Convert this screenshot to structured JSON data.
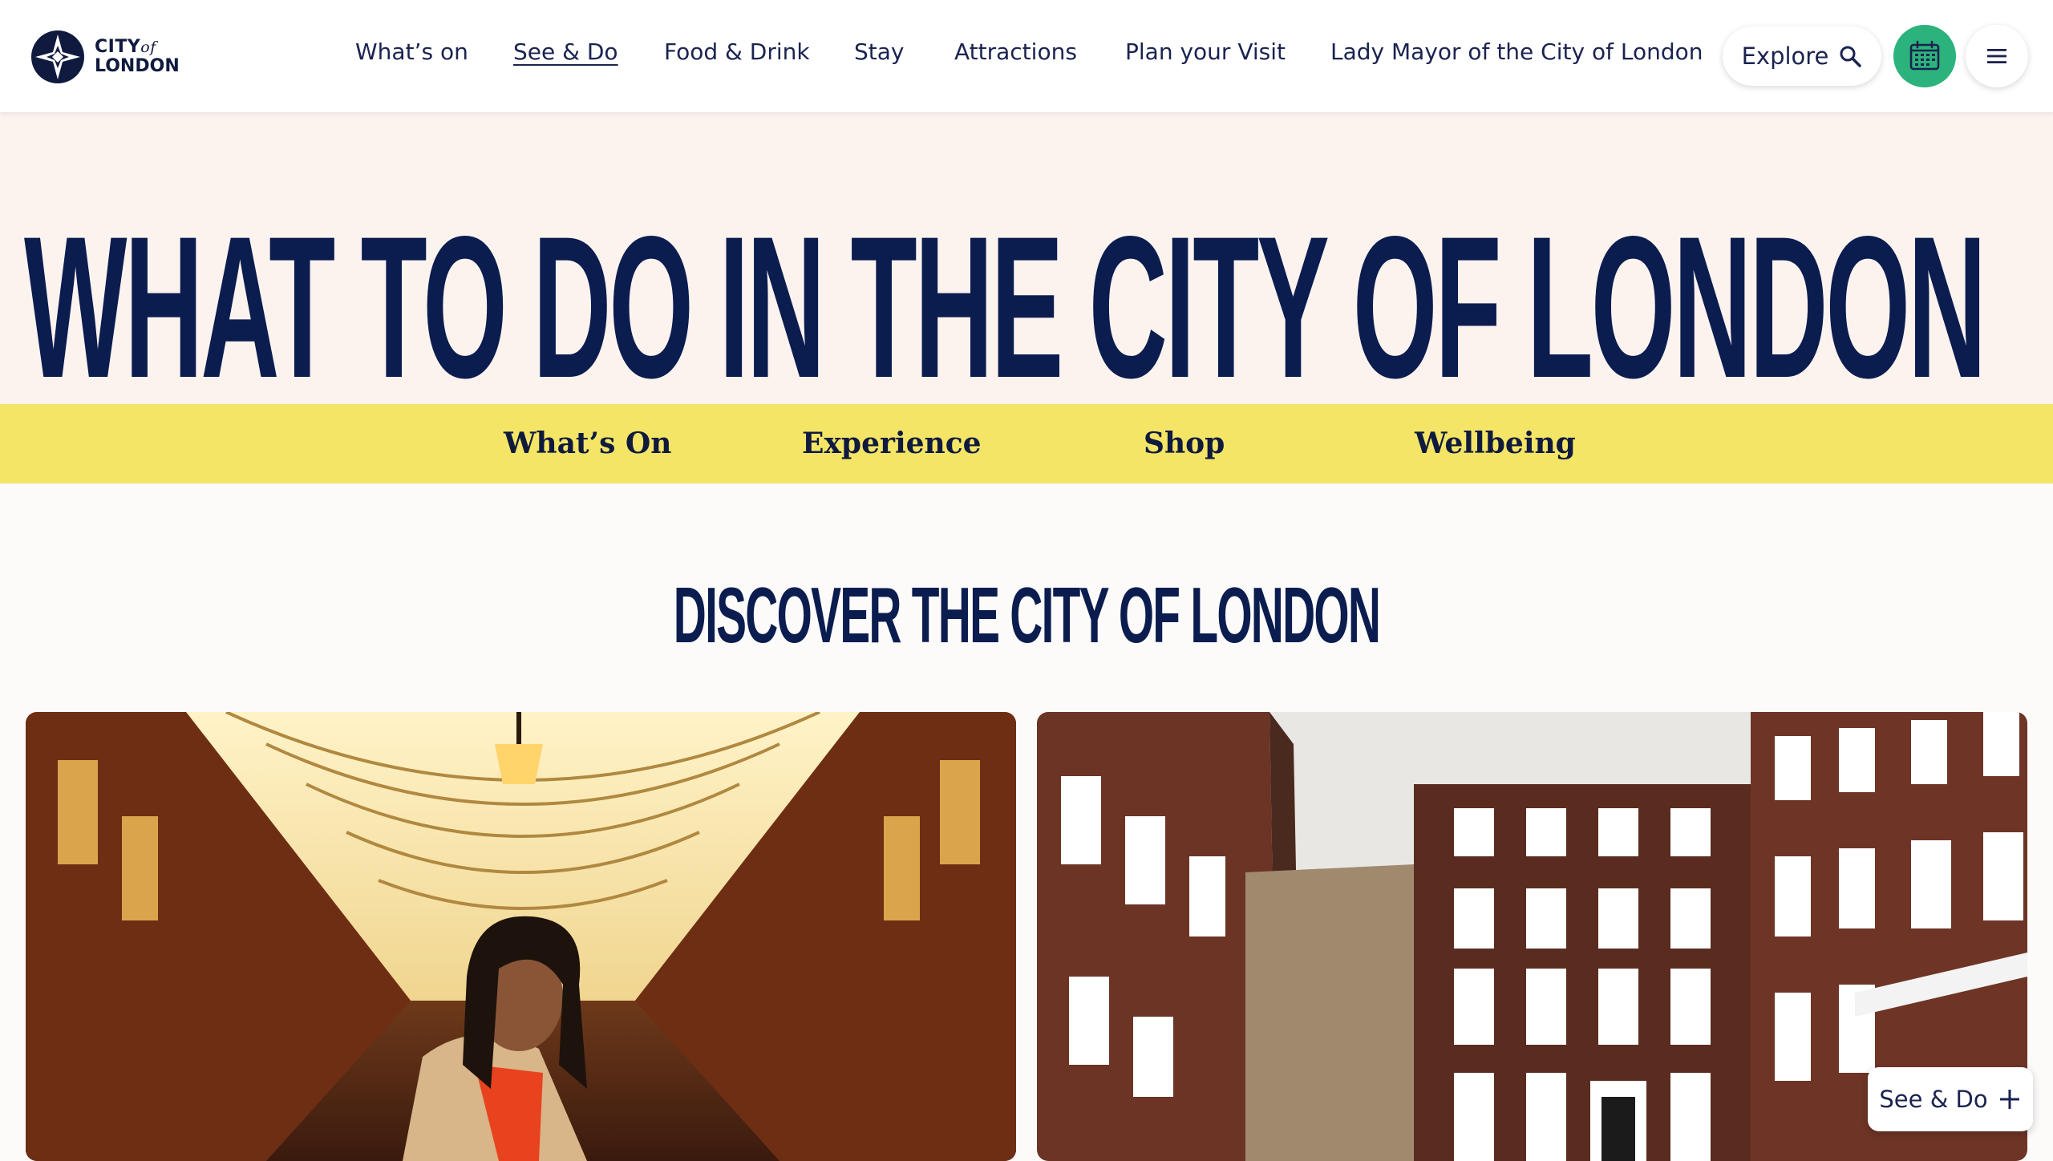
{
  "brand": {
    "logo_line1": "CITY",
    "logo_line1_suffix": "of",
    "logo_line2": "LONDON"
  },
  "header": {
    "nav": [
      {
        "label": "What’s on",
        "current": false
      },
      {
        "label": "See & Do",
        "current": true
      },
      {
        "label": "Food & Drink",
        "current": false
      },
      {
        "label": "Stay",
        "current": false
      },
      {
        "label": "Attractions",
        "current": false
      },
      {
        "label": "Plan your Visit",
        "current": false
      },
      {
        "label": "Lady Mayor of the City of London",
        "current": false
      }
    ],
    "explore_label": "Explore",
    "explore_icon": "search-icon",
    "calendar_icon": "calendar-icon",
    "menu_icon": "hamburger-menu-icon"
  },
  "hero": {
    "title": "WHAT TO DO IN THE CITY OF LONDON"
  },
  "subnav": {
    "items": [
      "What’s On",
      "Experience",
      "Shop",
      "Wellbeing"
    ]
  },
  "discover": {
    "title": "DISCOVER THE CITY OF LONDON"
  },
  "floating_button": {
    "label": "See & Do",
    "icon": "plus-icon"
  },
  "colors": {
    "navy": "#0b1c4f",
    "accent_green": "#2bb37b",
    "subnav_yellow": "#f5e566",
    "hero_bg": "#fcf3ef"
  }
}
